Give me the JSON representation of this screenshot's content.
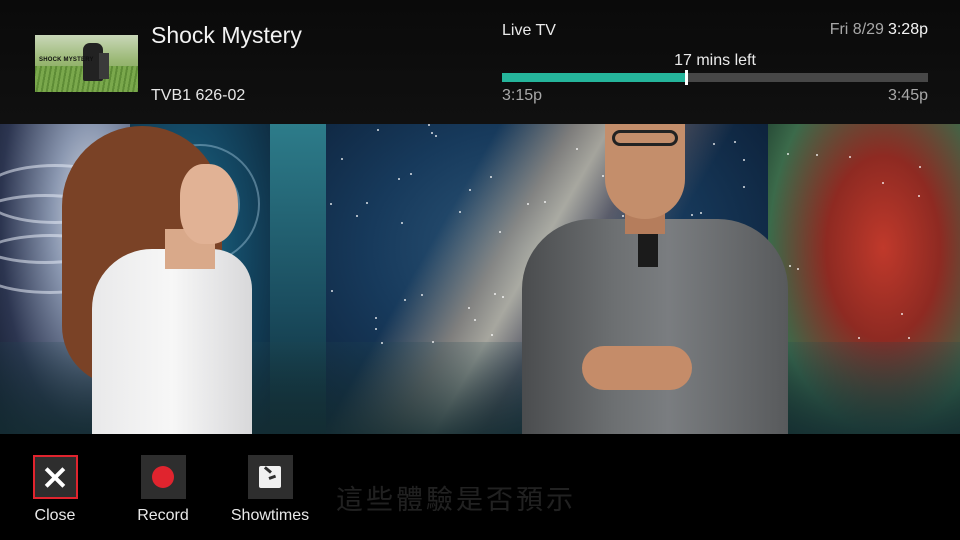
{
  "program": {
    "title": "Shock Mystery",
    "channel": "TVB1 626-02",
    "thumbnail_text": "SHOCK MYSTERY"
  },
  "status": {
    "source": "Live TV",
    "day": "Fri 8/29",
    "clock": "3:28p"
  },
  "progress": {
    "remaining_text": "17 mins left",
    "start_time": "3:15p",
    "end_time": "3:45p",
    "fraction_elapsed": 0.433,
    "fill_color": "#25b59b"
  },
  "video": {
    "subtitle": "這些體驗是否預示"
  },
  "controls": {
    "close": {
      "label": "Close",
      "icon": "close-icon",
      "selected": true
    },
    "record": {
      "label": "Record",
      "icon": "record-icon",
      "icon_color": "#e0242e"
    },
    "showtimes": {
      "label": "Showtimes",
      "icon": "clock-icon"
    }
  }
}
